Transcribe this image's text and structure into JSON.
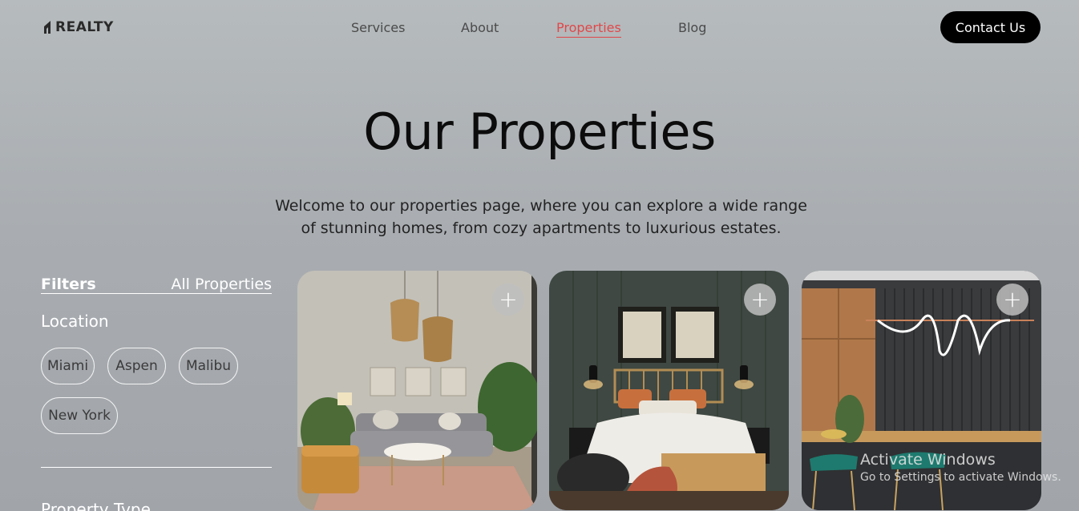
{
  "header": {
    "logo_text": "REALTY",
    "nav": [
      {
        "label": "Services",
        "active": false
      },
      {
        "label": "About",
        "active": false
      },
      {
        "label": "Properties",
        "active": true
      },
      {
        "label": "Blog",
        "active": false
      }
    ],
    "contact_label": "Contact Us"
  },
  "hero": {
    "title": "Our Properties",
    "description": "Welcome to our properties page, where you can explore a wide range of stunning homes, from cozy apartments to luxurious estates."
  },
  "filters": {
    "title": "Filters",
    "all_label": "All Properties",
    "location_title": "Location",
    "locations": [
      "Miami",
      "Aspen",
      "Malibu",
      "New York"
    ],
    "property_type_title": "Property Type"
  },
  "cards": [
    {
      "scene": "living-room",
      "action_icon": "plus-icon"
    },
    {
      "scene": "bedroom",
      "action_icon": "plus-icon"
    },
    {
      "scene": "kitchen",
      "action_icon": "plus-icon"
    }
  ],
  "watermark": {
    "title": "Activate Windows",
    "subtitle": "Go to Settings to activate Windows."
  },
  "colors": {
    "accent": "#e0484a",
    "button_bg": "#000000",
    "text": "#111111"
  }
}
